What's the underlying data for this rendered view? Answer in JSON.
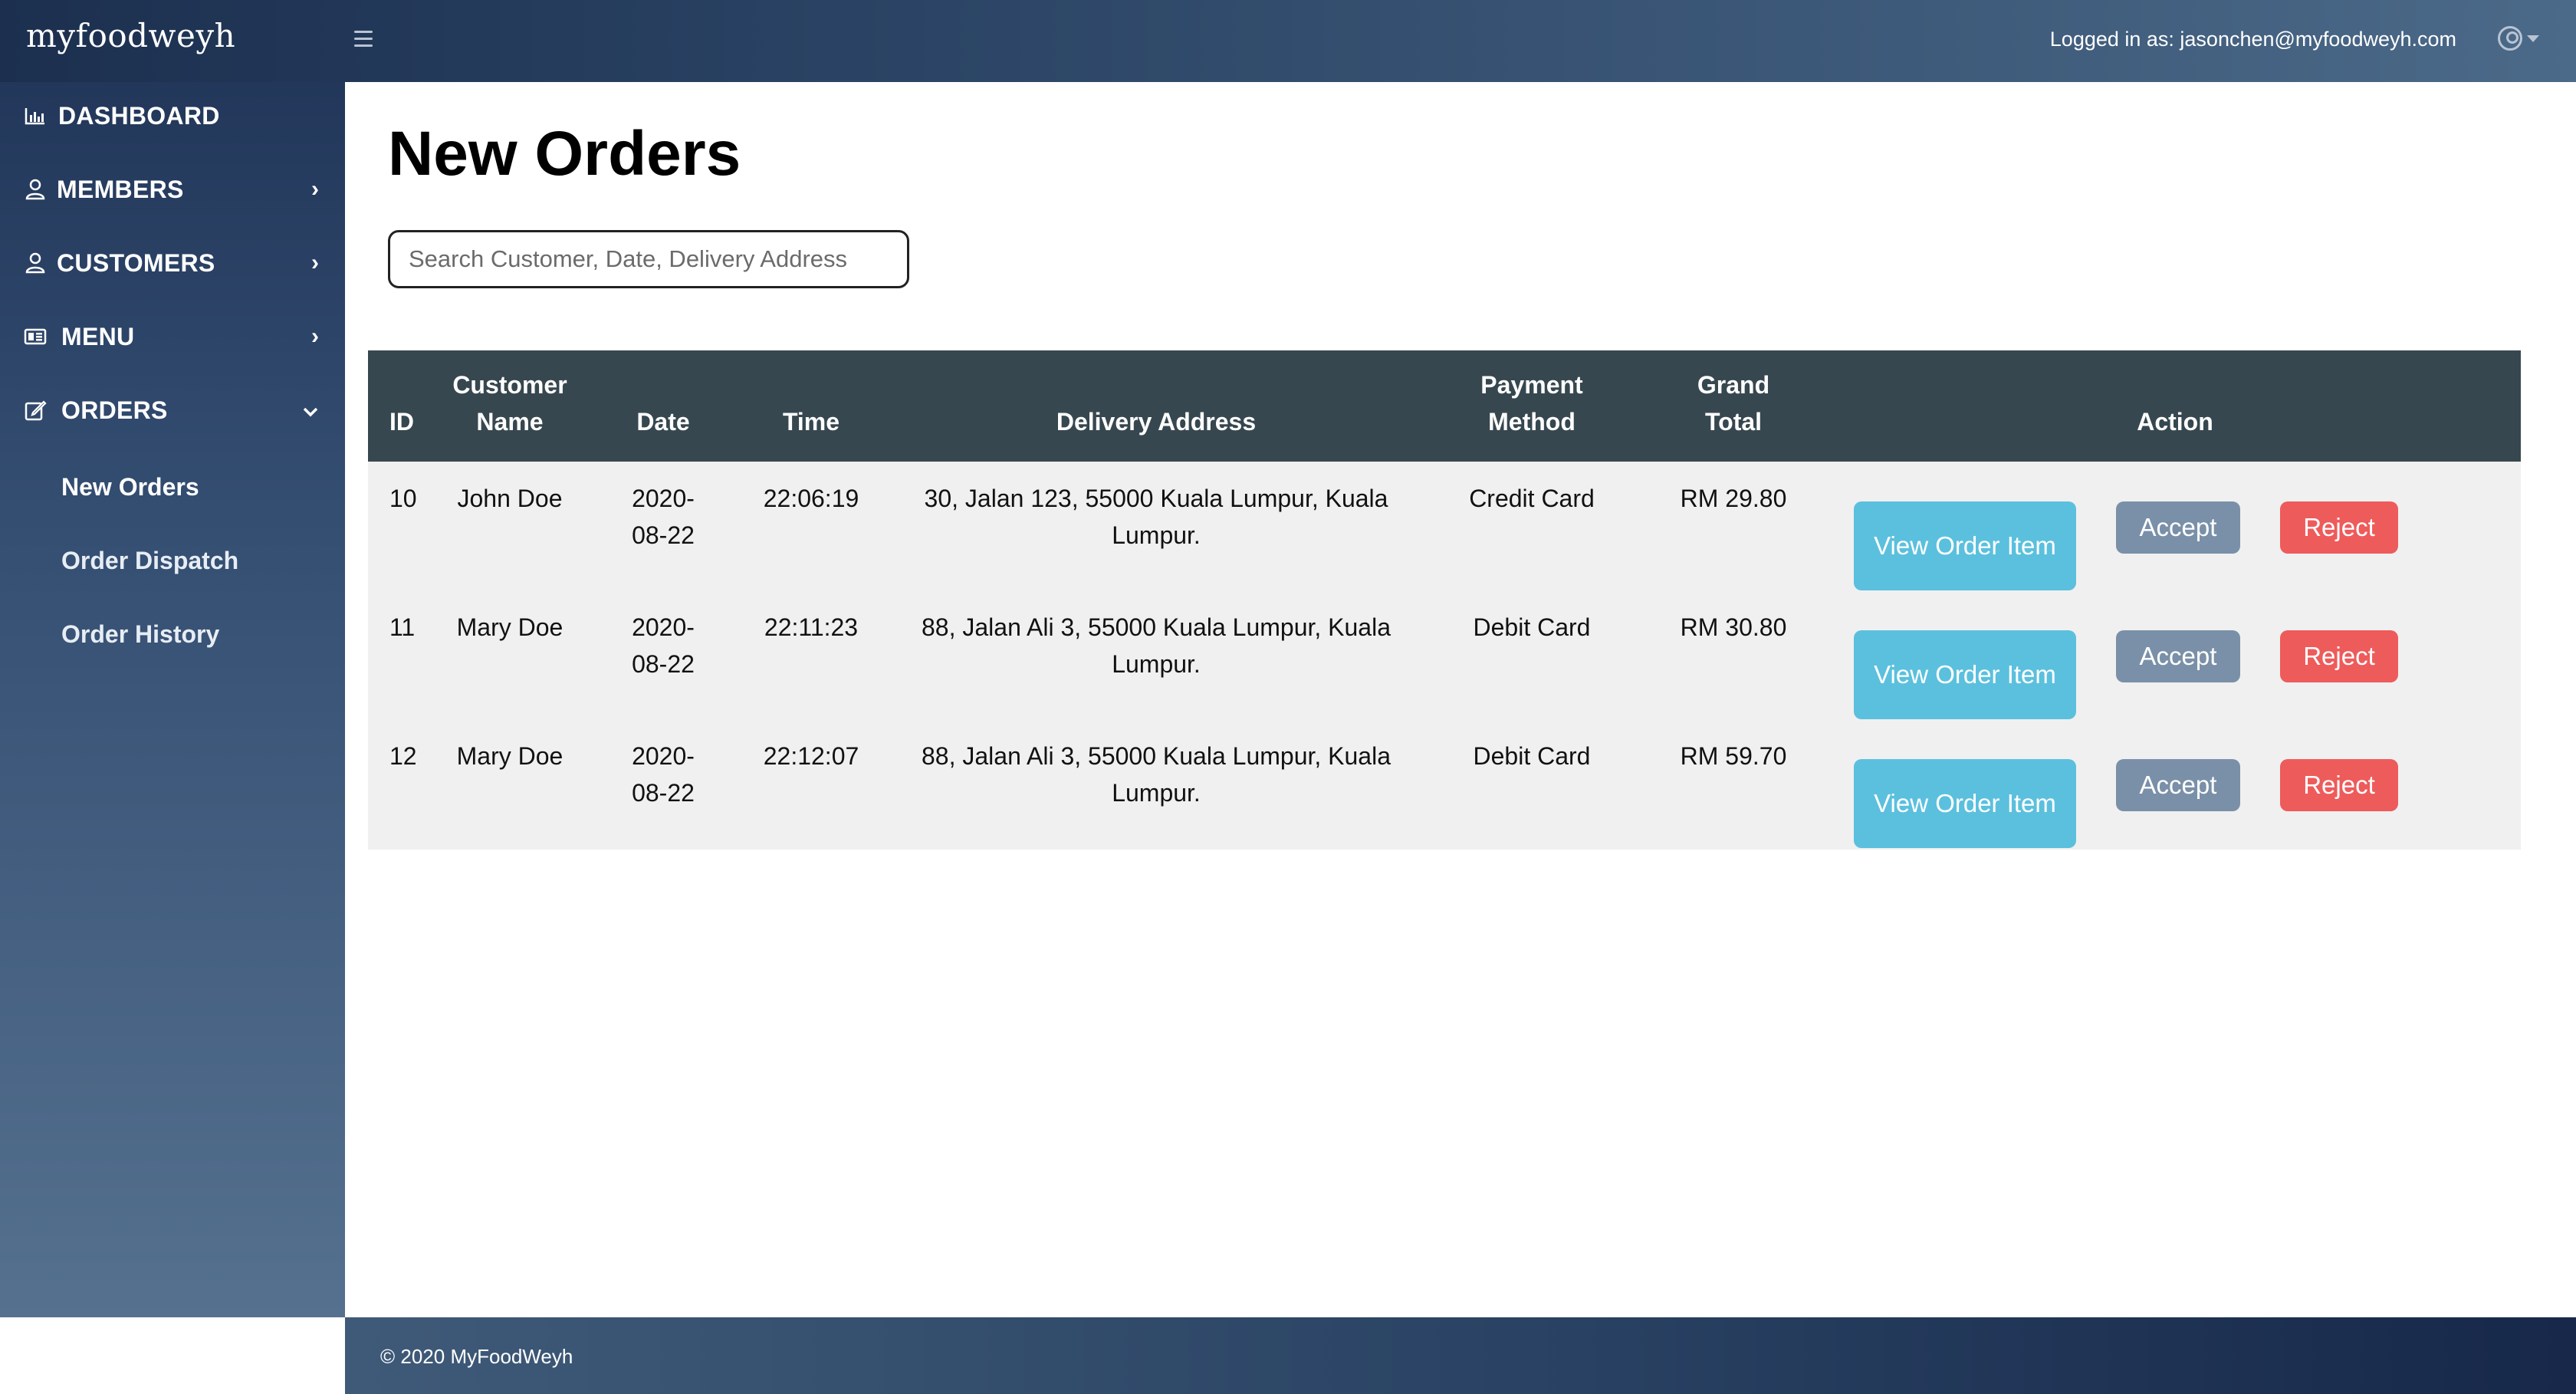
{
  "app": {
    "brand": "myfoodweyh",
    "logged_in_text": "Logged in as: jasonchen@myfoodweyh.com"
  },
  "sidebar": {
    "items": [
      {
        "label": "DASHBOARD",
        "icon": "chart-icon"
      },
      {
        "label": "MEMBERS",
        "icon": "user-icon",
        "chevron": "›"
      },
      {
        "label": "CUSTOMERS",
        "icon": "user-icon",
        "chevron": "›"
      },
      {
        "label": "MENU",
        "icon": "menu-card-icon",
        "chevron": "›"
      },
      {
        "label": "ORDERS",
        "icon": "edit-icon",
        "chevron": "⌄"
      }
    ],
    "orders_submenu": [
      "New Orders",
      "Order Dispatch",
      "Order History"
    ]
  },
  "main": {
    "title": "New Orders",
    "search_placeholder": "Search Customer, Date, Delivery Address",
    "table": {
      "headers": [
        "ID",
        "Customer Name",
        "Date",
        "Time",
        "Delivery Address",
        "Payment Method",
        "Grand Total",
        "Action"
      ],
      "rows": [
        {
          "id": "10",
          "customer": "John Doe",
          "date": "2020-08-22",
          "time": "22:06:19",
          "address": "30, Jalan 123, 55000 Kuala Lumpur, Kuala Lumpur.",
          "payment": "Credit Card",
          "total": "RM 29.80"
        },
        {
          "id": "11",
          "customer": "Mary Doe",
          "date": "2020-08-22",
          "time": "22:11:23",
          "address": "88, Jalan Ali 3, 55000 Kuala Lumpur, Kuala Lumpur.",
          "payment": "Debit Card",
          "total": "RM 30.80"
        },
        {
          "id": "12",
          "customer": "Mary Doe",
          "date": "2020-08-22",
          "time": "22:12:07",
          "address": "88, Jalan Ali 3, 55000 Kuala Lumpur, Kuala Lumpur.",
          "payment": "Debit Card",
          "total": "RM 59.70"
        }
      ],
      "actions": {
        "view": "View Order Item",
        "accept": "Accept",
        "reject": "Reject"
      }
    }
  },
  "footer": {
    "text": "© 2020 MyFoodWeyh"
  },
  "colors": {
    "table_header": "#37474f",
    "row_bg": "#f0f0f0",
    "view_button": "#5bc0de",
    "accept_button": "#7a90a8",
    "reject_button": "#ee5b5b"
  }
}
